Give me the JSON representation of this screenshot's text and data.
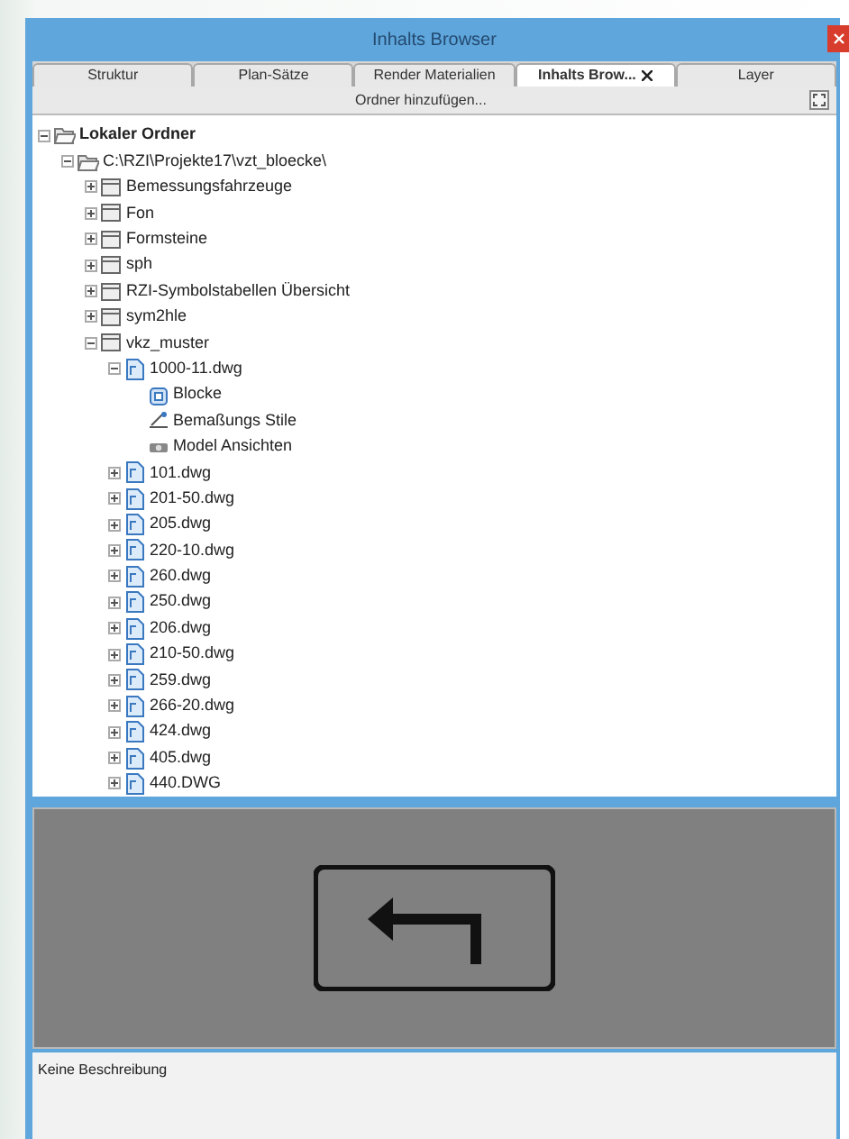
{
  "window": {
    "title": "Inhalts Browser"
  },
  "tabs": [
    {
      "label": "Struktur",
      "selected": false
    },
    {
      "label": "Plan-Sätze",
      "selected": false
    },
    {
      "label": "Render Materialien",
      "selected": false
    },
    {
      "label": "Inhalts Brow...",
      "selected": true,
      "closable": true
    },
    {
      "label": "Layer",
      "selected": false
    }
  ],
  "toolbar": {
    "button": "Ordner hinzufügen..."
  },
  "tree": [
    {
      "label": "Lokaler Ordner",
      "kind": "root",
      "expanded": true,
      "children": [
        {
          "label": "C:\\RZI\\Projekte17\\vzt_bloecke\\",
          "kind": "root",
          "expanded": true,
          "children": [
            {
              "label": "Bemessungsfahrzeuge",
              "kind": "folder",
              "expanded": false
            },
            {
              "label": "Fon",
              "kind": "folder",
              "expanded": false
            },
            {
              "label": "Formsteine",
              "kind": "folder",
              "expanded": false
            },
            {
              "label": "sph",
              "kind": "folder",
              "expanded": false
            },
            {
              "label": "RZI-Symbolstabellen Übersicht",
              "kind": "folder",
              "expanded": false
            },
            {
              "label": "sym2hle",
              "kind": "folder",
              "expanded": false
            },
            {
              "label": "vkz_muster",
              "kind": "folder",
              "expanded": true,
              "children": [
                {
                  "label": "1000-11.dwg",
                  "kind": "drawing",
                  "expanded": true,
                  "children": [
                    {
                      "label": "Blocke",
                      "kind": "blocks"
                    },
                    {
                      "label": "Bemaßungs Stile",
                      "kind": "dimstyles"
                    },
                    {
                      "label": "Model Ansichten",
                      "kind": "views"
                    }
                  ]
                },
                {
                  "label": "101.dwg",
                  "kind": "drawing",
                  "expanded": false
                },
                {
                  "label": "201-50.dwg",
                  "kind": "drawing",
                  "expanded": false
                },
                {
                  "label": "205.dwg",
                  "kind": "drawing",
                  "expanded": false
                },
                {
                  "label": "220-10.dwg",
                  "kind": "drawing",
                  "expanded": false
                },
                {
                  "label": "260.dwg",
                  "kind": "drawing",
                  "expanded": false
                },
                {
                  "label": "250.dwg",
                  "kind": "drawing",
                  "expanded": false
                },
                {
                  "label": "206.dwg",
                  "kind": "drawing",
                  "expanded": false
                },
                {
                  "label": "210-50.dwg",
                  "kind": "drawing",
                  "expanded": false
                },
                {
                  "label": "259.dwg",
                  "kind": "drawing",
                  "expanded": false
                },
                {
                  "label": "266-20.dwg",
                  "kind": "drawing",
                  "expanded": false
                },
                {
                  "label": "424.dwg",
                  "kind": "drawing",
                  "expanded": false
                },
                {
                  "label": "405.dwg",
                  "kind": "drawing",
                  "expanded": false
                },
                {
                  "label": "440.DWG",
                  "kind": "drawing",
                  "expanded": false
                }
              ]
            }
          ]
        }
      ]
    }
  ],
  "description": "Keine Beschreibung"
}
